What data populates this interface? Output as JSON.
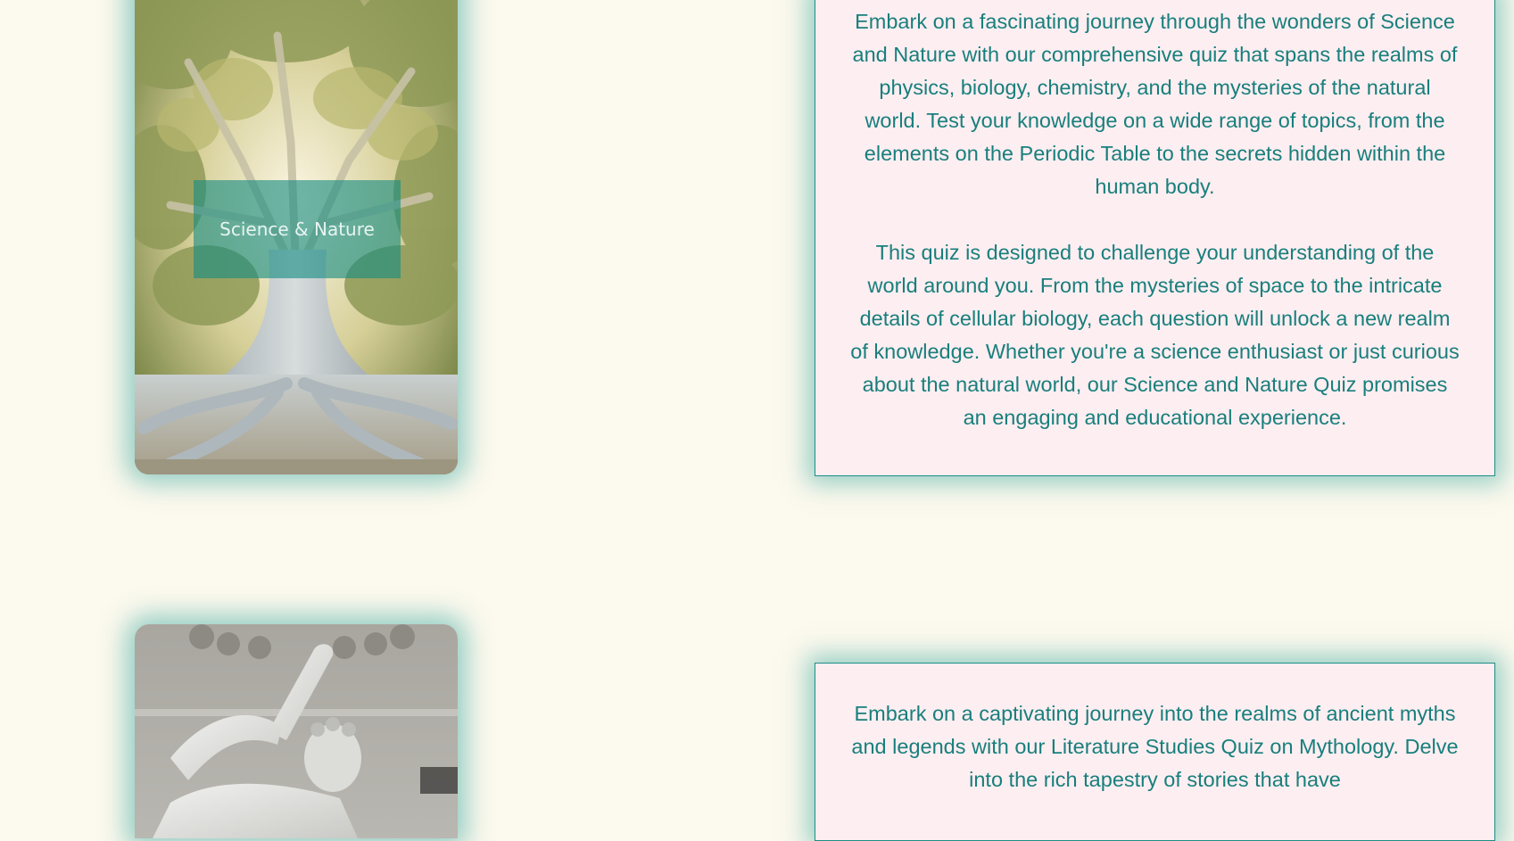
{
  "cards": [
    {
      "label": "Science & Nature",
      "image": "banyan-tree-photo",
      "paragraphs": [
        "Embark on a fascinating journey through the wonders of Science and Nature with our comprehensive quiz that spans the realms of physics, biology, chemistry, and the mysteries of the natural world. Test your knowledge on a wide range of topics, from the elements on the Periodic Table to the secrets hidden within the human body.",
        "This quiz is designed to challenge your understanding of the world around you. From the mysteries of space to the intricate details of cellular biology, each question will unlock a new realm of knowledge. Whether you're a science enthusiast or just curious about the natural world, our Science and Nature Quiz promises an engaging and educational experience."
      ]
    },
    {
      "image": "hercules-statue-photo",
      "paragraphs": [
        "Embark on a captivating journey into the realms of ancient myths and legends with our Literature Studies Quiz on Mythology. Delve into the rich tapestry of stories that have"
      ]
    }
  ],
  "colors": {
    "background": "#fcf9ee",
    "accent": "#187f7c",
    "box_background": "#fdeef1",
    "label_overlay": "#178c82"
  }
}
